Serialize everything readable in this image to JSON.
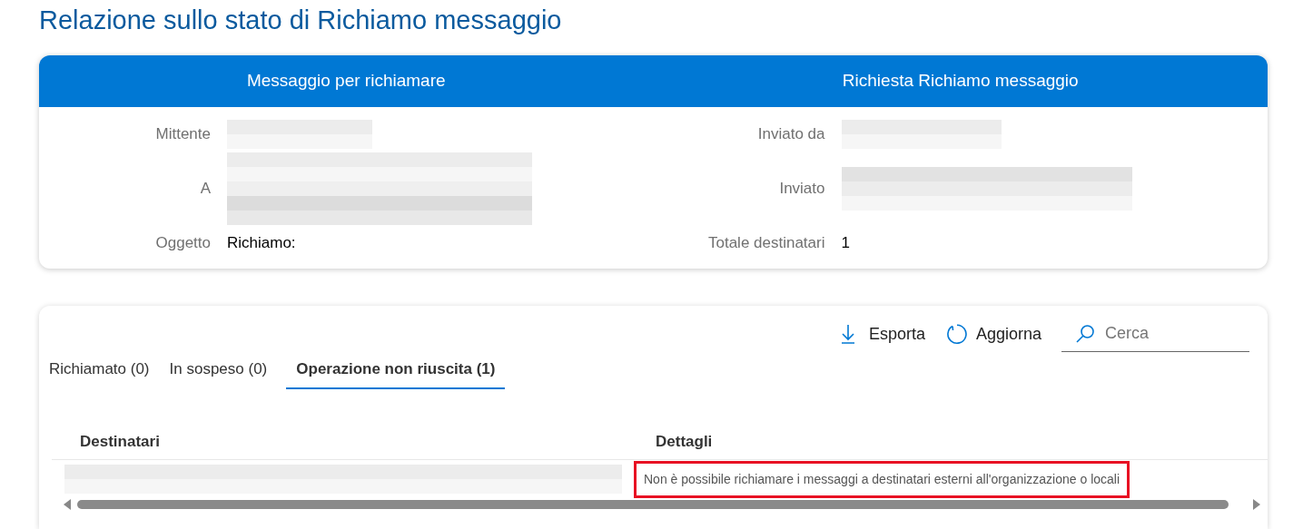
{
  "page_title": "Relazione sullo stato di Richiamo messaggio",
  "summary": {
    "columns": [
      {
        "heading": "Messaggio per richiamare",
        "fields": [
          {
            "label": "Mittente"
          },
          {
            "label": "A"
          },
          {
            "label": "Oggetto",
            "value": "Richiamo:"
          }
        ]
      },
      {
        "heading": "Richiesta Richiamo messaggio",
        "fields": [
          {
            "label": "Inviato da"
          },
          {
            "label": "Inviato"
          },
          {
            "label": "Totale destinatari",
            "value": "1"
          }
        ]
      }
    ]
  },
  "toolbar": {
    "export": "Esporta",
    "refresh": "Aggiorna",
    "search": {
      "placeholder": "Cerca"
    }
  },
  "tabs": [
    {
      "label": "Richiamato (0)",
      "selected": false
    },
    {
      "label": "In sospeso (0)",
      "selected": false
    },
    {
      "label": "Operazione non riuscita (1)",
      "selected": true
    }
  ],
  "table": {
    "columns": [
      "Destinatari",
      "Dettagli"
    ],
    "rows": [
      {
        "details": "Non è possibile richiamare i messaggi a destinatari esterni all'organizzazione o locali",
        "highlighted": true
      }
    ]
  }
}
